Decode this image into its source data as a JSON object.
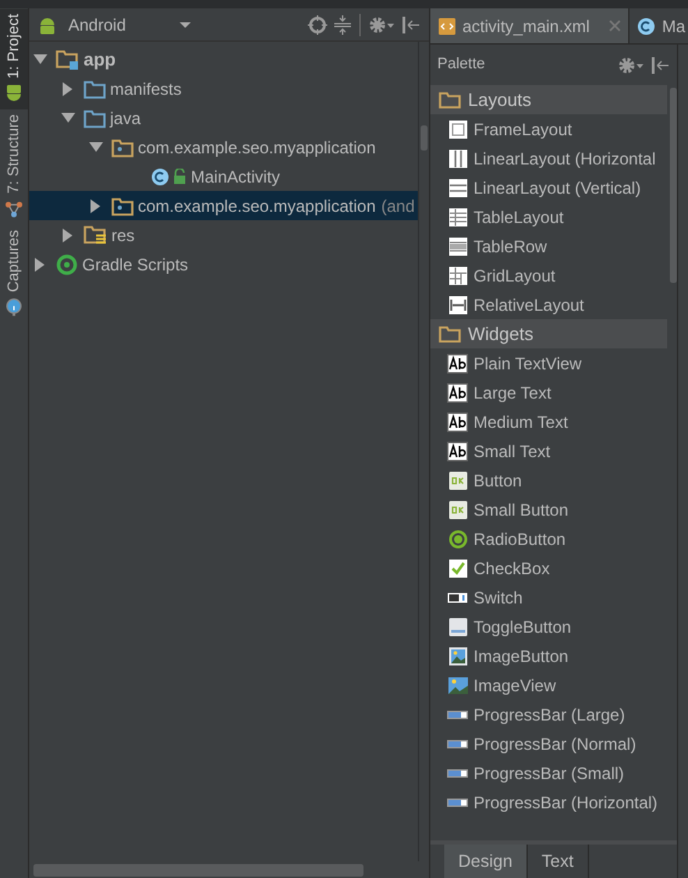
{
  "side_tabs": [
    {
      "label": "1: Project",
      "selected": true,
      "kind": "android"
    },
    {
      "label": "7: Structure",
      "selected": false,
      "kind": "structure"
    },
    {
      "label": "Captures",
      "selected": false,
      "kind": "captures"
    }
  ],
  "project": {
    "view": "Android",
    "tree": [
      {
        "label": "app",
        "kind": "module",
        "expanded": true,
        "selected": false,
        "children": [
          {
            "label": "manifests",
            "kind": "folder",
            "expanded": false,
            "selected": false
          },
          {
            "label": "java",
            "kind": "folder",
            "expanded": true,
            "selected": false,
            "children": [
              {
                "label": "com.example.seo.myapplication",
                "kind": "package",
                "expanded": true,
                "selected": false,
                "children": [
                  {
                    "label": "MainActivity",
                    "kind": "class",
                    "selected": false
                  }
                ]
              },
              {
                "label": "com.example.seo.myapplication",
                "suffix": "(and",
                "kind": "package",
                "expanded": false,
                "selected": true
              }
            ]
          },
          {
            "label": "res",
            "kind": "res",
            "expanded": false,
            "selected": false
          }
        ]
      },
      {
        "label": "Gradle Scripts",
        "kind": "gradle",
        "expanded": false,
        "selected": false
      }
    ]
  },
  "editor_tabs": [
    {
      "label": "activity_main.xml",
      "kind": "xml",
      "selected": true
    },
    {
      "label": "Ma",
      "kind": "class",
      "selected": false
    }
  ],
  "palette": {
    "title": "Palette",
    "groups": [
      {
        "label": "Layouts",
        "items": [
          {
            "label": "FrameLayout",
            "kind": "frame"
          },
          {
            "label": "LinearLayout (Horizontal",
            "kind": "hlinear"
          },
          {
            "label": "LinearLayout (Vertical)",
            "kind": "vlinear"
          },
          {
            "label": "TableLayout",
            "kind": "table"
          },
          {
            "label": "TableRow",
            "kind": "tablerow"
          },
          {
            "label": "GridLayout",
            "kind": "grid"
          },
          {
            "label": "RelativeLayout",
            "kind": "relative"
          }
        ]
      },
      {
        "label": "Widgets",
        "items": [
          {
            "label": "Plain TextView",
            "kind": "text"
          },
          {
            "label": "Large Text",
            "kind": "text"
          },
          {
            "label": "Medium Text",
            "kind": "text"
          },
          {
            "label": "Small Text",
            "kind": "text"
          },
          {
            "label": "Button",
            "kind": "ok"
          },
          {
            "label": "Small Button",
            "kind": "ok"
          },
          {
            "label": "RadioButton",
            "kind": "radio"
          },
          {
            "label": "CheckBox",
            "kind": "check"
          },
          {
            "label": "Switch",
            "kind": "switch"
          },
          {
            "label": "ToggleButton",
            "kind": "toggle"
          },
          {
            "label": "ImageButton",
            "kind": "imagebutton"
          },
          {
            "label": "ImageView",
            "kind": "image"
          },
          {
            "label": "ProgressBar (Large)",
            "kind": "progress"
          },
          {
            "label": "ProgressBar (Normal)",
            "kind": "progress"
          },
          {
            "label": "ProgressBar (Small)",
            "kind": "progress"
          },
          {
            "label": "ProgressBar (Horizontal)",
            "kind": "progress"
          }
        ]
      }
    ]
  },
  "bottom_tabs": [
    {
      "label": "Design",
      "selected": true
    },
    {
      "label": "Text",
      "selected": false
    }
  ]
}
